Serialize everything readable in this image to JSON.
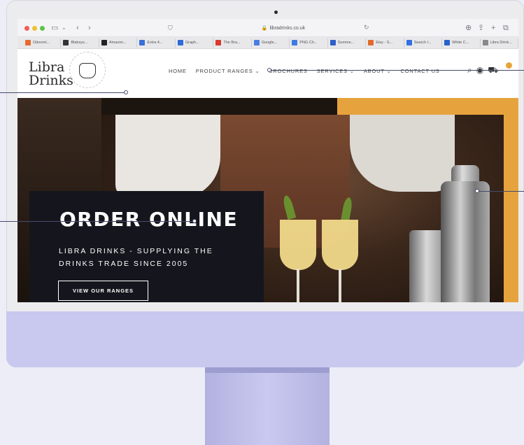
{
  "browser": {
    "url": "libradrinks.co.uk",
    "tabs": [
      {
        "label": "Odoorel...",
        "color": "#e56b2e"
      },
      {
        "label": "Blabsys...",
        "color": "#333333"
      },
      {
        "label": "Amazon...",
        "color": "#222222"
      },
      {
        "label": "Extra 4...",
        "color": "#3a6fd8"
      },
      {
        "label": "Graph...",
        "color": "#2e6bd6"
      },
      {
        "label": "The Bra...",
        "color": "#d9392f"
      },
      {
        "label": "Google...",
        "color": "#4a7de0"
      },
      {
        "label": "PNG Ch...",
        "color": "#3d7be0"
      },
      {
        "label": "Summe...",
        "color": "#3060c8"
      },
      {
        "label": "Etsy - S...",
        "color": "#e06a2a"
      },
      {
        "label": "Search l...",
        "color": "#3471e0"
      },
      {
        "label": "White C...",
        "color": "#2a62cc"
      },
      {
        "label": "Libra Drink...",
        "color": "#888888"
      }
    ]
  },
  "site": {
    "logo_line1": "Libra",
    "logo_line2": "Drinks",
    "nav": [
      "HOME",
      "PRODUCT RANGES ⌄",
      "BROCHURES",
      "SERVICES ⌄",
      "ABOUT ⌄",
      "CONTACT US"
    ]
  },
  "hero": {
    "title": "ORDER ONLINE",
    "subtitle": "LIBRA DRINKS - SUPPLYING THE DRINKS TRADE SINCE 2005",
    "button_label": "VIEW OUR RANGES"
  },
  "colors": {
    "accent": "#e6a33d",
    "hero_box": "#15161d",
    "imac_chin": "#c9c8ee"
  },
  "icons": [
    "sidebar-toggle-icon",
    "back-icon",
    "forward-icon",
    "shield-icon",
    "lock-icon",
    "reload-icon",
    "download-icon",
    "share-icon",
    "new-tab-icon",
    "tabs-overview-icon",
    "search-icon",
    "account-icon",
    "cart-icon"
  ]
}
